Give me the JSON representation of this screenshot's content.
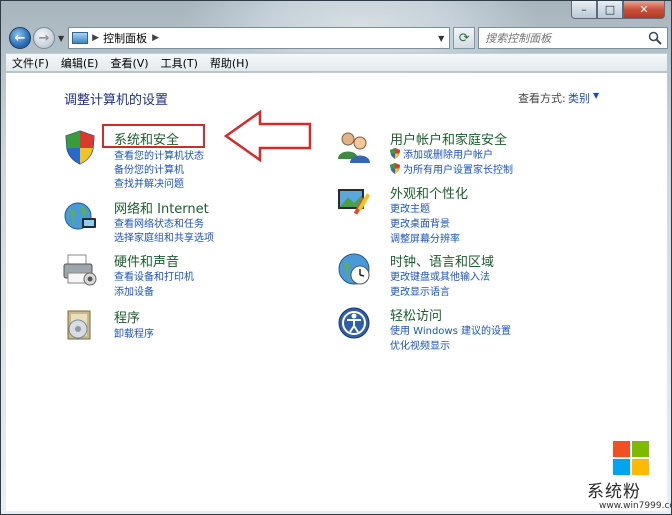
{
  "window": {
    "caption": {
      "minimize": "–",
      "maximize": "□",
      "close": "✕"
    }
  },
  "navbar": {
    "address_crumb": "控制面板",
    "search_placeholder": "搜索控制面板"
  },
  "menubar": {
    "items": [
      "文件(F)",
      "编辑(E)",
      "查看(V)",
      "工具(T)",
      "帮助(H)"
    ]
  },
  "content": {
    "heading": "调整计算机的设置",
    "view_by_label": "查看方式:",
    "view_by_value": "类别",
    "left_categories": [
      {
        "title": "系统和安全",
        "links": [
          "查看您的计算机状态",
          "备份您的计算机",
          "查找并解决问题"
        ],
        "icon": "shield-icon"
      },
      {
        "title": "网络和 Internet",
        "links": [
          "查看网络状态和任务",
          "选择家庭组和共享选项"
        ],
        "icon": "network-globe-icon"
      },
      {
        "title": "硬件和声音",
        "links": [
          "查看设备和打印机",
          "添加设备"
        ],
        "icon": "printer-icon"
      },
      {
        "title": "程序",
        "links": [
          "卸载程序"
        ],
        "icon": "programs-icon"
      }
    ],
    "right_categories": [
      {
        "title": "用户帐户和家庭安全",
        "links": [
          "添加或删除用户帐户",
          "为所有用户设置家长控制"
        ],
        "icon": "users-icon"
      },
      {
        "title": "外观和个性化",
        "links": [
          "更改主题",
          "更改桌面背景",
          "调整屏幕分辨率"
        ],
        "icon": "appearance-icon"
      },
      {
        "title": "时钟、语言和区域",
        "links": [
          "更改键盘或其他输入法",
          "更改显示语言"
        ],
        "icon": "clock-globe-icon"
      },
      {
        "title": "轻松访问",
        "links": [
          "使用 Windows 建议的设置",
          "优化视频显示"
        ],
        "icon": "ease-of-access-icon"
      }
    ]
  },
  "watermark": {
    "brand": "系统粉",
    "url": "www.win7999.com"
  },
  "colors": {
    "title_green": "#1d5c2d",
    "link_blue": "#1b55bb",
    "heading_blue": "#1e3287",
    "highlight_red": "#d42a2a"
  }
}
